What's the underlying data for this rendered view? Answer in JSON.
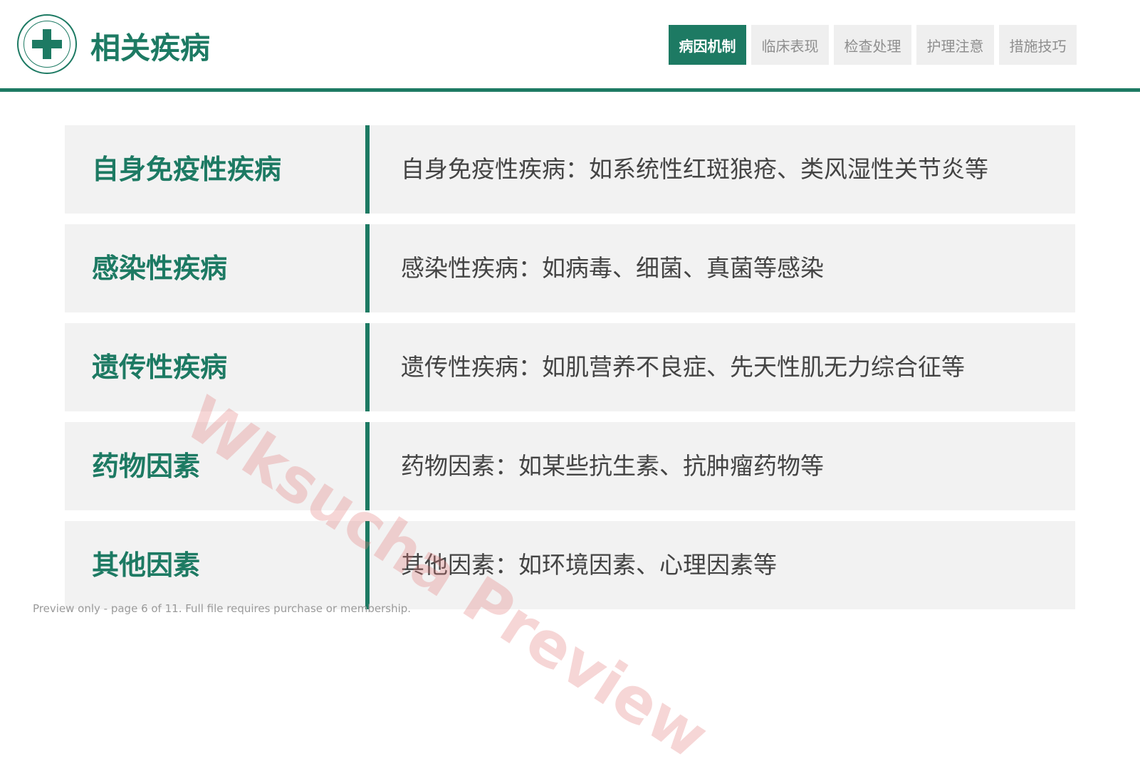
{
  "header": {
    "title": "相关疾病",
    "logo_icon": "medical-cross-icon",
    "accent_color": "#1d7a63",
    "tabs": [
      {
        "label": "病因机制",
        "active": true
      },
      {
        "label": "临床表现",
        "active": false
      },
      {
        "label": "检查处理",
        "active": false
      },
      {
        "label": "护理注意",
        "active": false
      },
      {
        "label": "措施技巧",
        "active": false
      }
    ]
  },
  "rows": [
    {
      "label": "自身免疫性疾病",
      "text": "自身免疫性疾病：如系统性红斑狼疮、类风湿性关节炎等"
    },
    {
      "label": "感染性疾病",
      "text": "感染性疾病：如病毒、细菌、真菌等感染"
    },
    {
      "label": "遗传性疾病",
      "text": "遗传性疾病：如肌营养不良症、先天性肌无力综合征等"
    },
    {
      "label": "药物因素",
      "text": "药物因素：如某些抗生素、抗肿瘤药物等"
    },
    {
      "label": "其他因素",
      "text": "其他因素：如环境因素、心理因素等"
    }
  ],
  "watermark": "Wksucha Preview",
  "footer_note": "Preview only - page 6 of 11. Full file requires purchase or membership."
}
